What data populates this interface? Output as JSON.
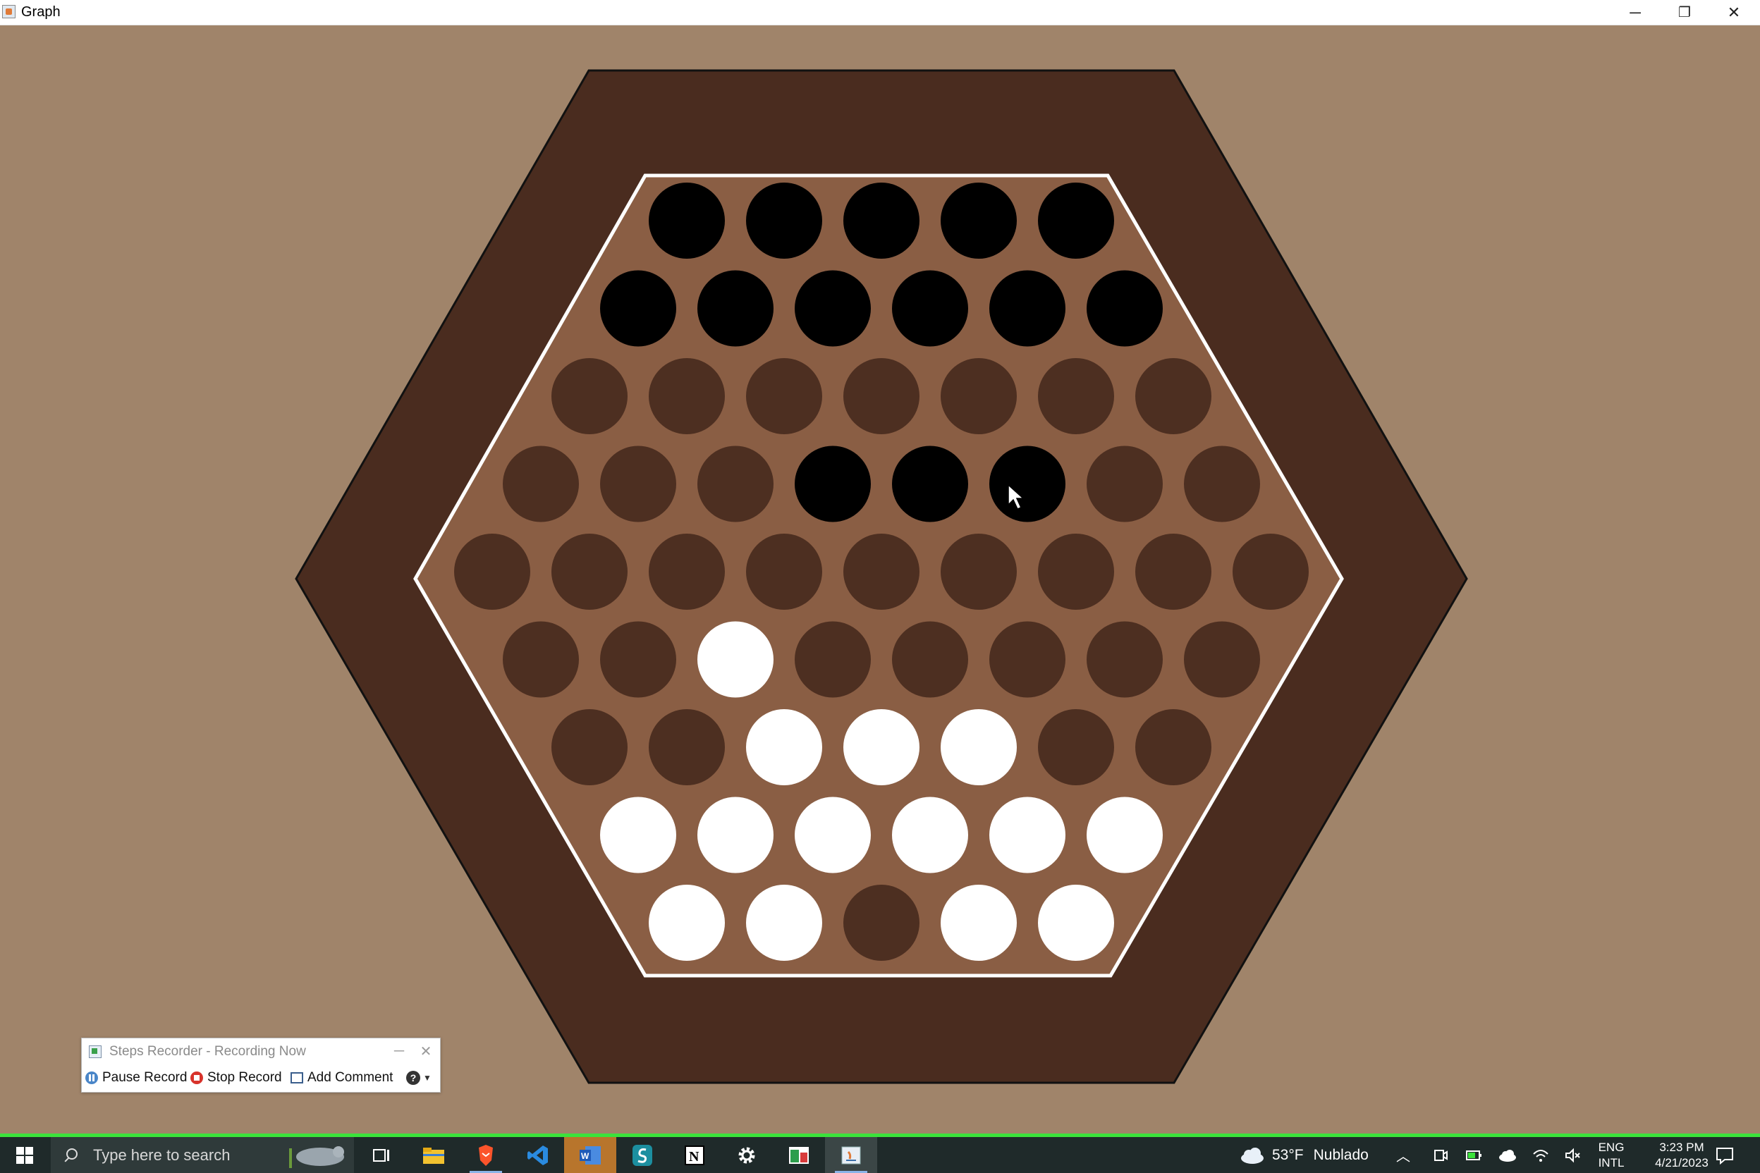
{
  "window": {
    "title": "Graph",
    "controls": {
      "minimize": "─",
      "restore": "❐",
      "close": "✕"
    }
  },
  "colors": {
    "background": "#a0846a",
    "board_frame": "#4a2c1f",
    "board_inner": "#8a5e44",
    "empty_hole": "#4d2f21",
    "black_piece": "#000000",
    "white_piece": "#ffffff"
  },
  "board": {
    "rows": [
      [
        "B",
        "B",
        "B",
        "B",
        "B"
      ],
      [
        "B",
        "B",
        "B",
        "B",
        "B",
        "B"
      ],
      [
        "E",
        "E",
        "E",
        "E",
        "E",
        "E",
        "E"
      ],
      [
        "E",
        "E",
        "E",
        "B",
        "B",
        "B",
        "E",
        "E"
      ],
      [
        "E",
        "E",
        "E",
        "E",
        "E",
        "E",
        "E",
        "E",
        "E"
      ],
      [
        "E",
        "E",
        "W",
        "E",
        "E",
        "E",
        "E",
        "E"
      ],
      [
        "E",
        "E",
        "W",
        "W",
        "W",
        "E",
        "E"
      ],
      [
        "W",
        "W",
        "W",
        "W",
        "W",
        "W"
      ],
      [
        "W",
        "W",
        "E",
        "W",
        "W"
      ]
    ]
  },
  "steps_recorder": {
    "title": "Steps Recorder - Recording Now",
    "pause_label": "Pause Record",
    "stop_label": "Stop Record",
    "comment_label": "Add Comment",
    "help_label": "?"
  },
  "taskbar": {
    "search_placeholder": "Type here to search",
    "apps": [
      "task-view",
      "file-explorer",
      "brave",
      "vscode",
      "word",
      "sublime",
      "notion",
      "settings",
      "spreadsheet",
      "java-app"
    ],
    "weather_temp": "53°F",
    "weather_text": "Nublado",
    "lang_top": "ENG",
    "lang_bottom": "INTL",
    "time": "3:23 PM",
    "date": "4/21/2023"
  }
}
